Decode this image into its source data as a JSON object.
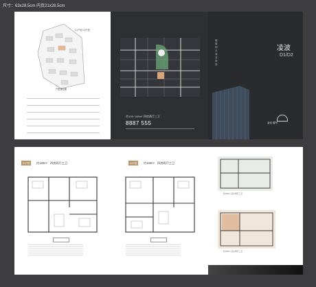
{
  "header": {
    "size_text": "尺寸：63x28.5cm 内页21x28.5cm"
  },
  "colors": {
    "gold": "#b9956a",
    "dark_panel": "#2e2f33",
    "background": "#3d3d3f",
    "accent_green": "#6fae7a",
    "accent_orange": "#d8a47a"
  },
  "front": {
    "plot_title": "户型落位图",
    "plot_tag_a": "D1户型  D2户型",
    "map_text_lines": [
      "约108~188m²",
      "四房两厅三卫"
    ],
    "phone": "8887 555",
    "vertical_text": "璀璨明天 凌波府邸",
    "cover_title": "凌波",
    "cover_sub": "D1/D2",
    "brand_logo_text": "凌波·壹号"
  },
  "inner": {
    "page1": {
      "tag": "D1户型",
      "area": "约188m²",
      "layout": "四房两厅三卫"
    },
    "page2": {
      "tag": "D2户型",
      "area": "约188m²",
      "layout": "四房两厅三卫"
    },
    "page3": {
      "caption_top": "约188m² 四房两厅三卫",
      "caption_bottom": "约188m² 四房两厅三卫"
    }
  }
}
